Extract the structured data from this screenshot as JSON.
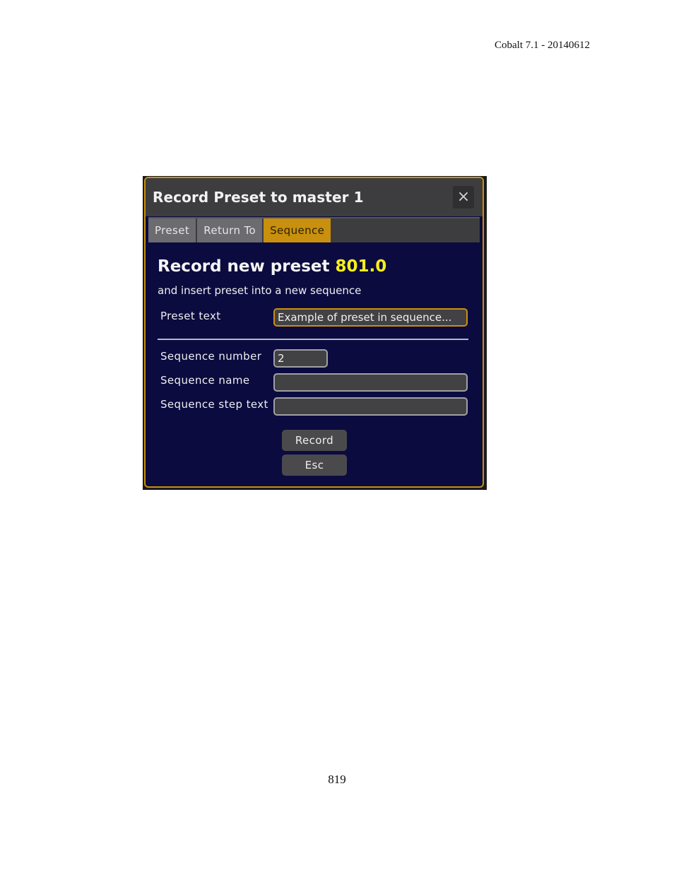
{
  "page": {
    "header": "Cobalt 7.1 - 20140612",
    "page_number": "819"
  },
  "dialog": {
    "title": "Record Preset to master 1",
    "close_icon": "×",
    "tabs": [
      {
        "label": "Preset",
        "active": false
      },
      {
        "label": "Return To",
        "active": false
      },
      {
        "label": "Sequence",
        "active": true
      }
    ],
    "heading": "Record new preset",
    "preset_number": "801.0",
    "subheading": "and insert preset into a new sequence",
    "fields": {
      "preset_text": {
        "label": "Preset text",
        "value": "Example of preset in sequence..."
      },
      "sequence_number": {
        "label": "Sequence number",
        "value": "2"
      },
      "sequence_name": {
        "label": "Sequence name",
        "value": ""
      },
      "sequence_step_text": {
        "label": "Sequence step text",
        "value": ""
      }
    },
    "buttons": {
      "record": "Record",
      "esc": "Esc"
    },
    "colors": {
      "accent": "#c8900e",
      "background": "#0b0b40",
      "preset_number": "#f7ef1a"
    }
  }
}
